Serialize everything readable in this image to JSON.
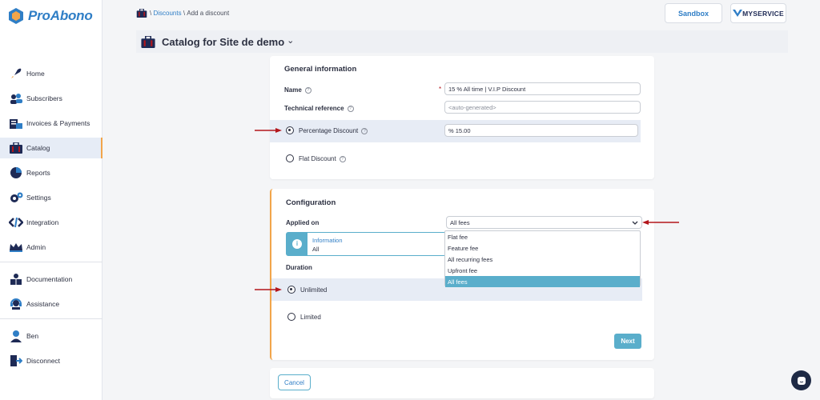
{
  "app": {
    "name": "ProAbono",
    "brand_color": "#2f7ec6",
    "accent_color": "#5aaecb",
    "active_border_color": "#f2a54a"
  },
  "sidebar": {
    "items": [
      {
        "label": "Home",
        "icon": "rocket-icon"
      },
      {
        "label": "Subscribers",
        "icon": "users-icon"
      },
      {
        "label": "Invoices & Payments",
        "icon": "invoices-icon"
      },
      {
        "label": "Catalog",
        "icon": "catalog-icon",
        "active": true
      },
      {
        "label": "Reports",
        "icon": "pie-chart-icon"
      },
      {
        "label": "Settings",
        "icon": "gears-icon"
      },
      {
        "label": "Integration",
        "icon": "code-icon"
      },
      {
        "label": "Admin",
        "icon": "crown-icon"
      }
    ],
    "help_items": [
      {
        "label": "Documentation",
        "icon": "book-icon"
      },
      {
        "label": "Assistance",
        "icon": "headset-icon"
      }
    ],
    "user_items": [
      {
        "label": "Ben",
        "icon": "user-icon"
      },
      {
        "label": "Disconnect",
        "icon": "logout-icon"
      }
    ]
  },
  "header": {
    "breadcrumb": {
      "sep1": "\\",
      "link": "Discounts",
      "sep2": "\\",
      "current": "Add a discount"
    },
    "sandbox_label": "Sandbox",
    "service_label": "MYSERVICE",
    "catalog_title": "Catalog for Site de demo",
    "catalog_chevron": "⌄"
  },
  "general": {
    "title": "General information",
    "name_label": "Name",
    "required_mark": "*",
    "name_value": "15 % All time | V.I.P Discount",
    "techref_label": "Technical reference",
    "techref_placeholder": "<auto-generated>",
    "percentage_label": "Percentage Discount",
    "percentage_value": "% 15.00",
    "flat_label": "Flat Discount",
    "help_mark": "?"
  },
  "config": {
    "title": "Configuration",
    "applied_label": "Applied on",
    "applied_value": "All fees",
    "dropdown_options": [
      "Flat fee",
      "Feature fee",
      "All recurring fees",
      "Upfront fee",
      "All fees"
    ],
    "selected_option": "All fees",
    "info_title": "Information",
    "info_value": "All",
    "info_icon": "i",
    "duration_label": "Duration",
    "unlimited_label": "Unlimited",
    "limited_label": "Limited",
    "next_label": "Next"
  },
  "footer": {
    "cancel_label": "Cancel"
  },
  "annotations": {
    "arrow_color": "#b3161c"
  }
}
